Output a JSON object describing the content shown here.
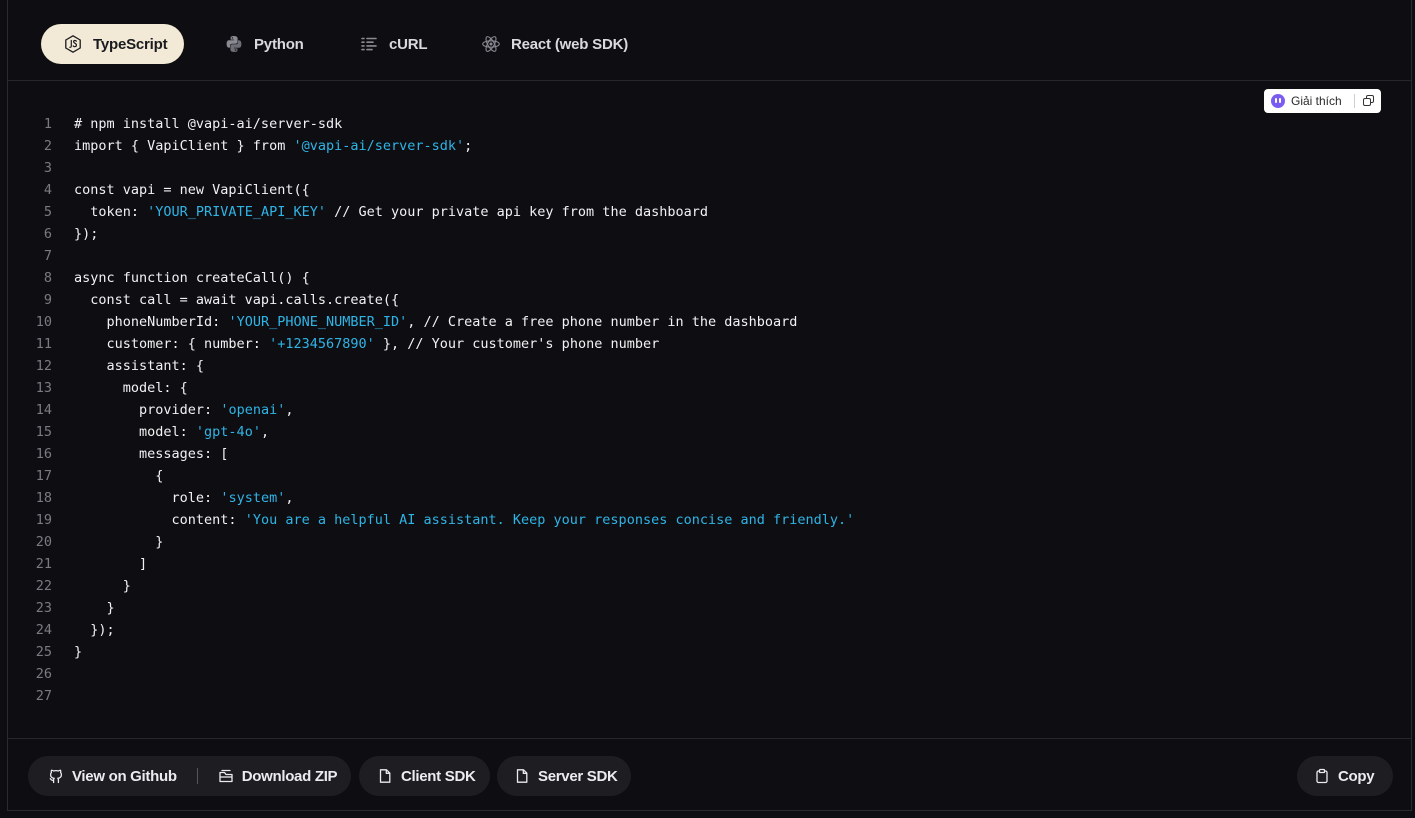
{
  "tabs": [
    {
      "label": "TypeScript",
      "icon": "nodejs-icon",
      "active": true
    },
    {
      "label": "Python",
      "icon": "python-icon",
      "active": false
    },
    {
      "label": "cURL",
      "icon": "list-icon",
      "active": false
    },
    {
      "label": "React (web SDK)",
      "icon": "react-icon",
      "active": false
    }
  ],
  "explain": {
    "label": "Giải thích"
  },
  "code": {
    "lines": [
      {
        "n": "1",
        "parts": [
          {
            "t": "# npm install @vapi-ai/server-sdk"
          }
        ]
      },
      {
        "n": "2",
        "parts": [
          {
            "t": "import { VapiClient } from "
          },
          {
            "t": "'@vapi-ai/server-sdk'",
            "s": true
          },
          {
            "t": ";"
          }
        ]
      },
      {
        "n": "3",
        "parts": []
      },
      {
        "n": "4",
        "parts": [
          {
            "t": "const vapi = new VapiClient({"
          }
        ]
      },
      {
        "n": "5",
        "parts": [
          {
            "t": "  token: "
          },
          {
            "t": "'YOUR_PRIVATE_API_KEY'",
            "s": true
          },
          {
            "t": " // Get your private api key from the dashboard"
          }
        ]
      },
      {
        "n": "6",
        "parts": [
          {
            "t": "});"
          }
        ]
      },
      {
        "n": "7",
        "parts": []
      },
      {
        "n": "8",
        "parts": [
          {
            "t": "async function createCall() {"
          }
        ]
      },
      {
        "n": "9",
        "parts": [
          {
            "t": "  const call = await vapi.calls.create({"
          }
        ]
      },
      {
        "n": "10",
        "parts": [
          {
            "t": "    phoneNumberId: "
          },
          {
            "t": "'YOUR_PHONE_NUMBER_ID'",
            "s": true
          },
          {
            "t": ", // Create a free phone number in the dashboard"
          }
        ]
      },
      {
        "n": "11",
        "parts": [
          {
            "t": "    customer: { number: "
          },
          {
            "t": "'+1234567890'",
            "s": true
          },
          {
            "t": " }, // Your customer's phone number"
          }
        ]
      },
      {
        "n": "12",
        "parts": [
          {
            "t": "    assistant: {"
          }
        ]
      },
      {
        "n": "13",
        "parts": [
          {
            "t": "      model: {"
          }
        ]
      },
      {
        "n": "14",
        "parts": [
          {
            "t": "        provider: "
          },
          {
            "t": "'openai'",
            "s": true
          },
          {
            "t": ","
          }
        ]
      },
      {
        "n": "15",
        "parts": [
          {
            "t": "        model: "
          },
          {
            "t": "'gpt-4o'",
            "s": true
          },
          {
            "t": ","
          }
        ]
      },
      {
        "n": "16",
        "parts": [
          {
            "t": "        messages: ["
          }
        ]
      },
      {
        "n": "17",
        "parts": [
          {
            "t": "          {"
          }
        ]
      },
      {
        "n": "18",
        "parts": [
          {
            "t": "            role: "
          },
          {
            "t": "'system'",
            "s": true
          },
          {
            "t": ","
          }
        ]
      },
      {
        "n": "19",
        "parts": [
          {
            "t": "            content: "
          },
          {
            "t": "'You are a helpful AI assistant. Keep your responses concise and friendly.'",
            "s": true
          }
        ]
      },
      {
        "n": "20",
        "parts": [
          {
            "t": "          }"
          }
        ]
      },
      {
        "n": "21",
        "parts": [
          {
            "t": "        ]"
          }
        ]
      },
      {
        "n": "22",
        "parts": [
          {
            "t": "      }"
          }
        ]
      },
      {
        "n": "23",
        "parts": [
          {
            "t": "    }"
          }
        ]
      },
      {
        "n": "24",
        "parts": [
          {
            "t": "  });"
          }
        ]
      },
      {
        "n": "25",
        "parts": [
          {
            "t": "}"
          }
        ]
      },
      {
        "n": "26",
        "parts": []
      },
      {
        "n": "27",
        "parts": []
      }
    ]
  },
  "footer": {
    "github_label": "View on Github",
    "zip_label": "Download ZIP",
    "client_sdk_label": "Client SDK",
    "server_sdk_label": "Server SDK",
    "copy_label": "Copy"
  },
  "colors": {
    "accent_tab": "#f2ead6",
    "string": "#2fb4e6",
    "background": "#0e0e12"
  }
}
